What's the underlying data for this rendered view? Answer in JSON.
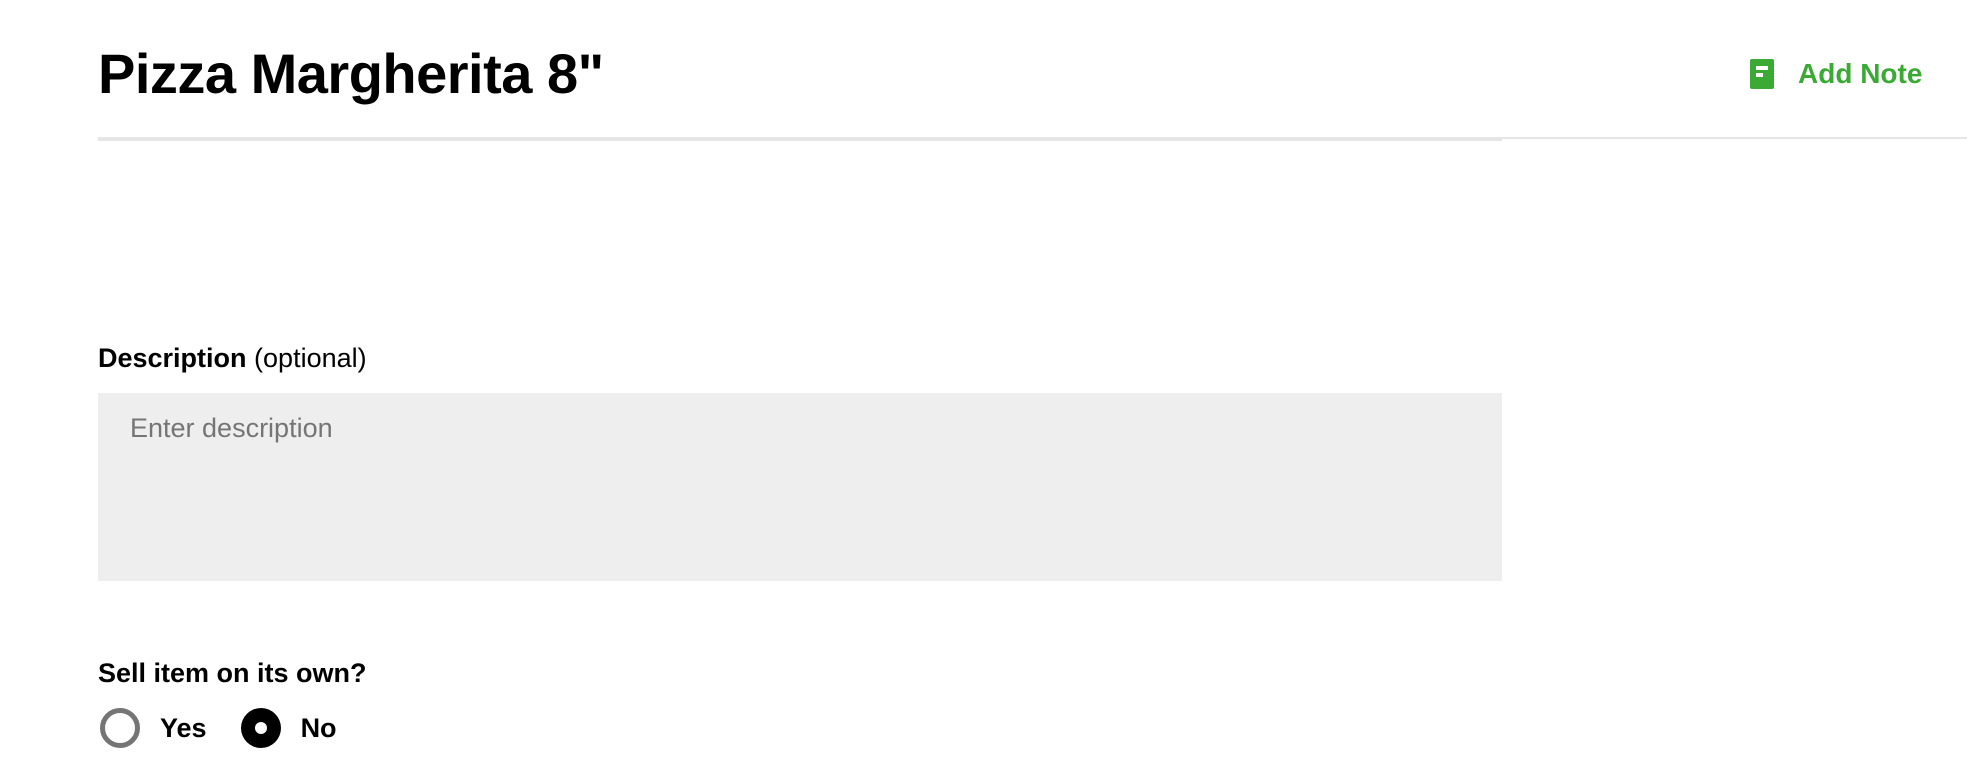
{
  "header": {
    "title": "Pizza Margherita 8\"",
    "add_note_label": "Add Note",
    "add_note_icon": "note-icon"
  },
  "description": {
    "label": "Description",
    "optional_text": "(optional)",
    "placeholder": "Enter description",
    "value": ""
  },
  "sell_on_own": {
    "question": "Sell item on its own?",
    "options": [
      {
        "label": "Yes",
        "selected": false
      },
      {
        "label": "No",
        "selected": true
      }
    ]
  },
  "colors": {
    "accent": "#3aaa35",
    "input_background": "#eeeeee",
    "divider": "#e6e6e6"
  }
}
